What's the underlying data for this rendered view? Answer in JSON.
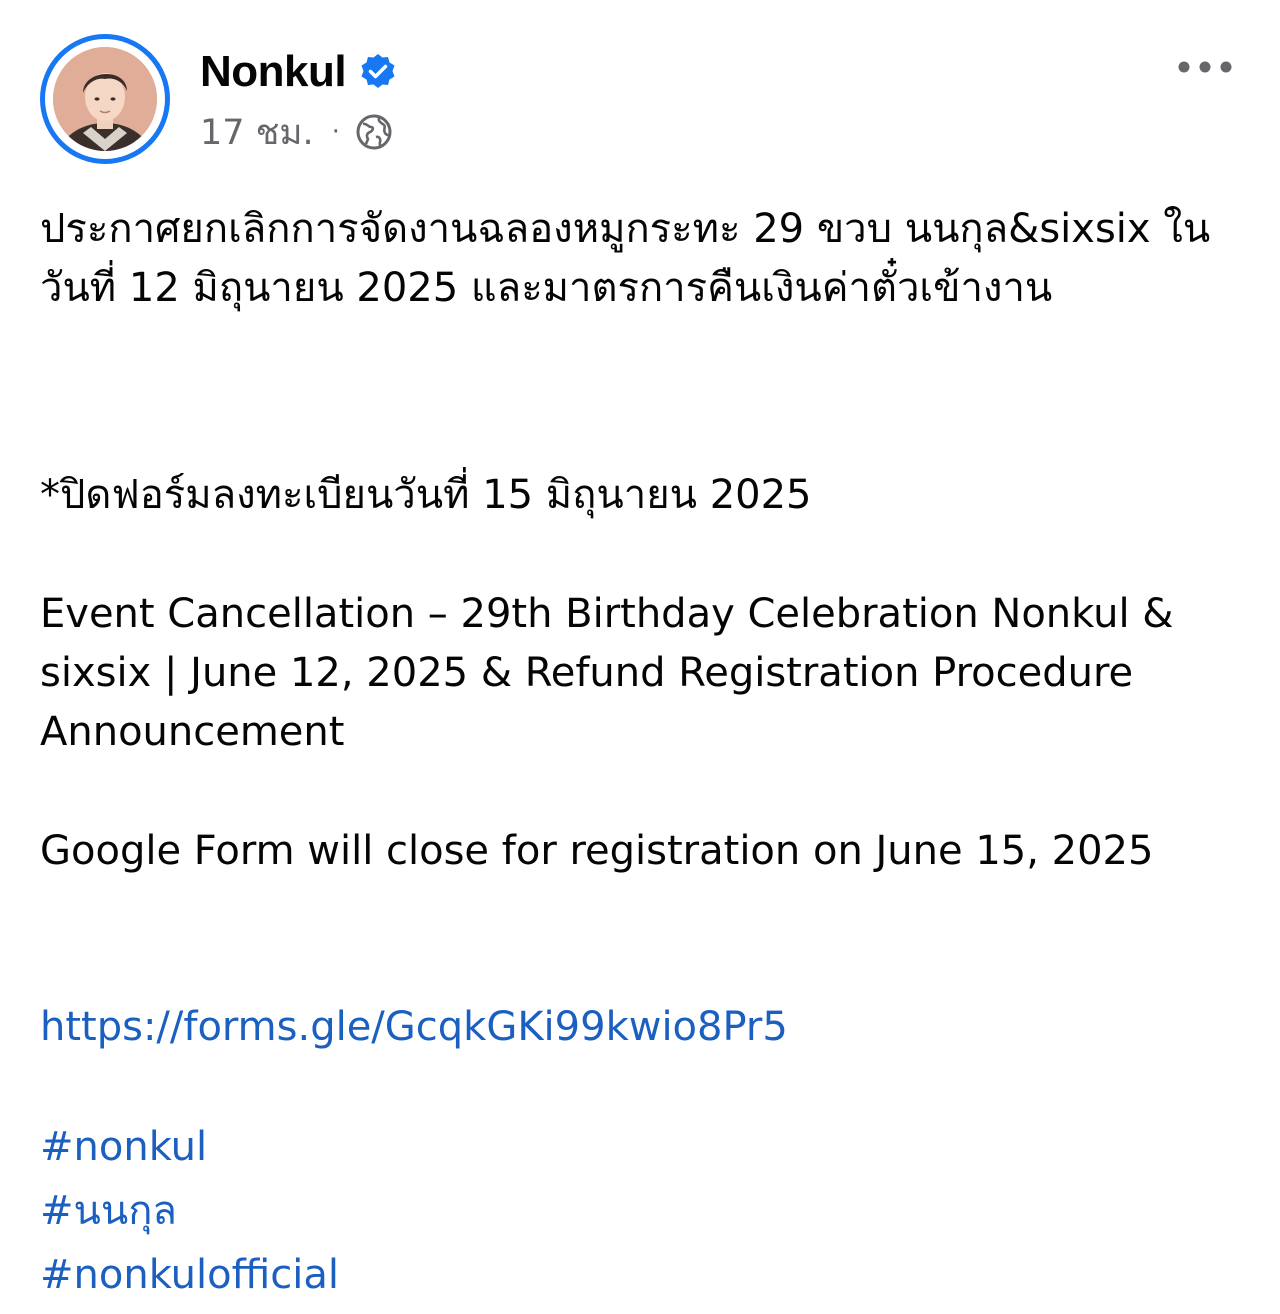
{
  "post": {
    "author": {
      "name": "Nonkul",
      "verified_icon": "verified-badge-icon"
    },
    "meta": {
      "time": "17 ชม.",
      "separator": "·",
      "audience_icon": "globe-icon"
    },
    "more_icon": "more-horizontal-icon",
    "text": {
      "thai_title": "ประกาศยกเลิกการจัดงานฉลองหมูกระทะ 29 ขวบ นนกุล&sixsix ในวันที่ 12 มิถุนายน 2025 และมาตรการคืนเงินค่าตั๋วเข้างาน",
      "thai_note": "*ปิดฟอร์มลงทะเบียนวันที่ 15 มิถุนายน 2025",
      "english_title": "Event Cancellation – 29th Birthday Celebration Nonkul & sixsix | June 12, 2025 & Refund Registration Procedure Announcement",
      "english_note": "Google Form will close for registration on June 15, 2025",
      "link": "https://forms.gle/GcqkGKi99kwio8Pr5",
      "hashtags": [
        "#nonkul",
        "#นนกุล",
        "#nonkulofficial"
      ]
    }
  },
  "colors": {
    "accent": "#1877f2",
    "link": "#1b5fc1",
    "meta": "#65676b",
    "text": "#050505"
  }
}
